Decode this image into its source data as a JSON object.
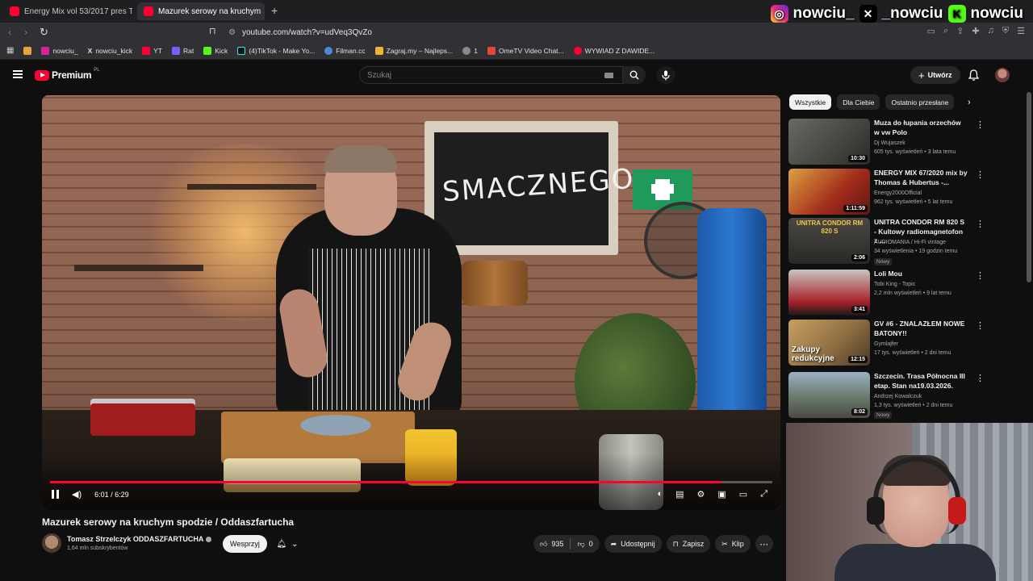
{
  "browser": {
    "tabs": [
      {
        "label": "Energy Mix vol 53/2017 pres Tho",
        "active": false
      },
      {
        "label": "Mazurek serowy na kruchym",
        "active": true
      }
    ],
    "new_tab": "+",
    "url": "youtube.com/watch?v=udVeq3QvZo",
    "bookmarks": [
      {
        "label": "nowciu_",
        "color": "#d6249f"
      },
      {
        "label": "nowciu_kick",
        "color": "#ffffff"
      },
      {
        "label": "YT",
        "color": "#ff0033"
      },
      {
        "label": "Rat",
        "color": "#7b5cff"
      },
      {
        "label": "Kick",
        "color": "#53fc18"
      },
      {
        "label": "(4)TikTok - Make Yo...",
        "color": "#25f4ee"
      },
      {
        "label": "Filman.cc",
        "color": "#4a8bd6"
      },
      {
        "label": "Zagraj.my – Najleps...",
        "color": "#f2b233"
      },
      {
        "label": "1",
        "color": "#888888"
      },
      {
        "label": "OmeTV Video Chat...",
        "color": "#e04a3a"
      },
      {
        "label": "WYWIAD Z DAWIDE...",
        "color": "#ff0033"
      }
    ]
  },
  "overlay": {
    "instagram": "nowciu_",
    "x": "_nowciu",
    "kick": "nowciu"
  },
  "yt": {
    "logo": "Premium",
    "logo_country": "PL",
    "search_placeholder": "Szukaj",
    "create_label": "Utwórz"
  },
  "player": {
    "time": "6:01 / 6:29",
    "progress": 0.93,
    "board_text": "SMACZNEGO"
  },
  "video": {
    "title": "Mazurek serowy na kruchym spodzie / Oddaszfartucha",
    "channel": "Tomasz Strzelczyk ODDASZFARTUCHA",
    "subs": "1,64 mln subskrybentów",
    "support_label": "Wesprzyj",
    "likes": "935",
    "dislikes": "0",
    "share_label": "Udostępnij",
    "save_label": "Zapisz",
    "clip_label": "Klip"
  },
  "chips": [
    "Wszystkie",
    "Dla Ciebie",
    "Ostatnio przesłane"
  ],
  "recommendations": [
    {
      "title": "Muza do łupania orzechów w vw Polo",
      "channel": "Dj Wujaszek",
      "stats": "605 tys. wyświetleń • 3 lata temu",
      "duration": "10:30",
      "badge": "",
      "thumb": "#3a3a38"
    },
    {
      "title": "ENERGY MIX 67/2020 mix by Thomas & Hubertus -...",
      "channel": "Energy2000Official",
      "stats": "962 tys. wyświetleń • 5 lat temu",
      "duration": "1:11:59",
      "badge": "",
      "thumb": "#b2462a"
    },
    {
      "title": "UNITRA CONDOR RM 820 S - Kultowy radiomagnetofon z ...",
      "channel": "AUDIOMANIA / Hi-Fi vintage",
      "stats": "34 wyświetlenia • 19 godzin temu",
      "duration": "2:06",
      "badge": "Nowy",
      "thumb": "#4a4a44"
    },
    {
      "title": "Loli Mou",
      "channel": "Tobi King - Topic",
      "stats": "2,2 mln wyświetleń • 9 lat temu",
      "duration": "3:41",
      "badge": "",
      "thumb": "#a8222a"
    },
    {
      "title": "GV #6 - ZNALAZŁEM NOWE BATONY!!",
      "channel": "Gymlajfer",
      "stats": "17 tys. wyświetleń • 2 dni temu",
      "duration": "12:15",
      "badge": "",
      "thumb": "#b08a52"
    },
    {
      "title": "Szczecin. Trasa Północna III etap. Stan na19.03.2026.",
      "channel": "Andrzej Kowalczuk",
      "stats": "1,3 tys. wyświetleń • 2 dni temu",
      "duration": "8:02",
      "badge": "Nowy",
      "thumb": "#6a7a88"
    }
  ],
  "rec_thumb_text": {
    "r3": "UNITRA CONDOR RM 820 S",
    "r5": "Zakupy redukcyjne"
  }
}
